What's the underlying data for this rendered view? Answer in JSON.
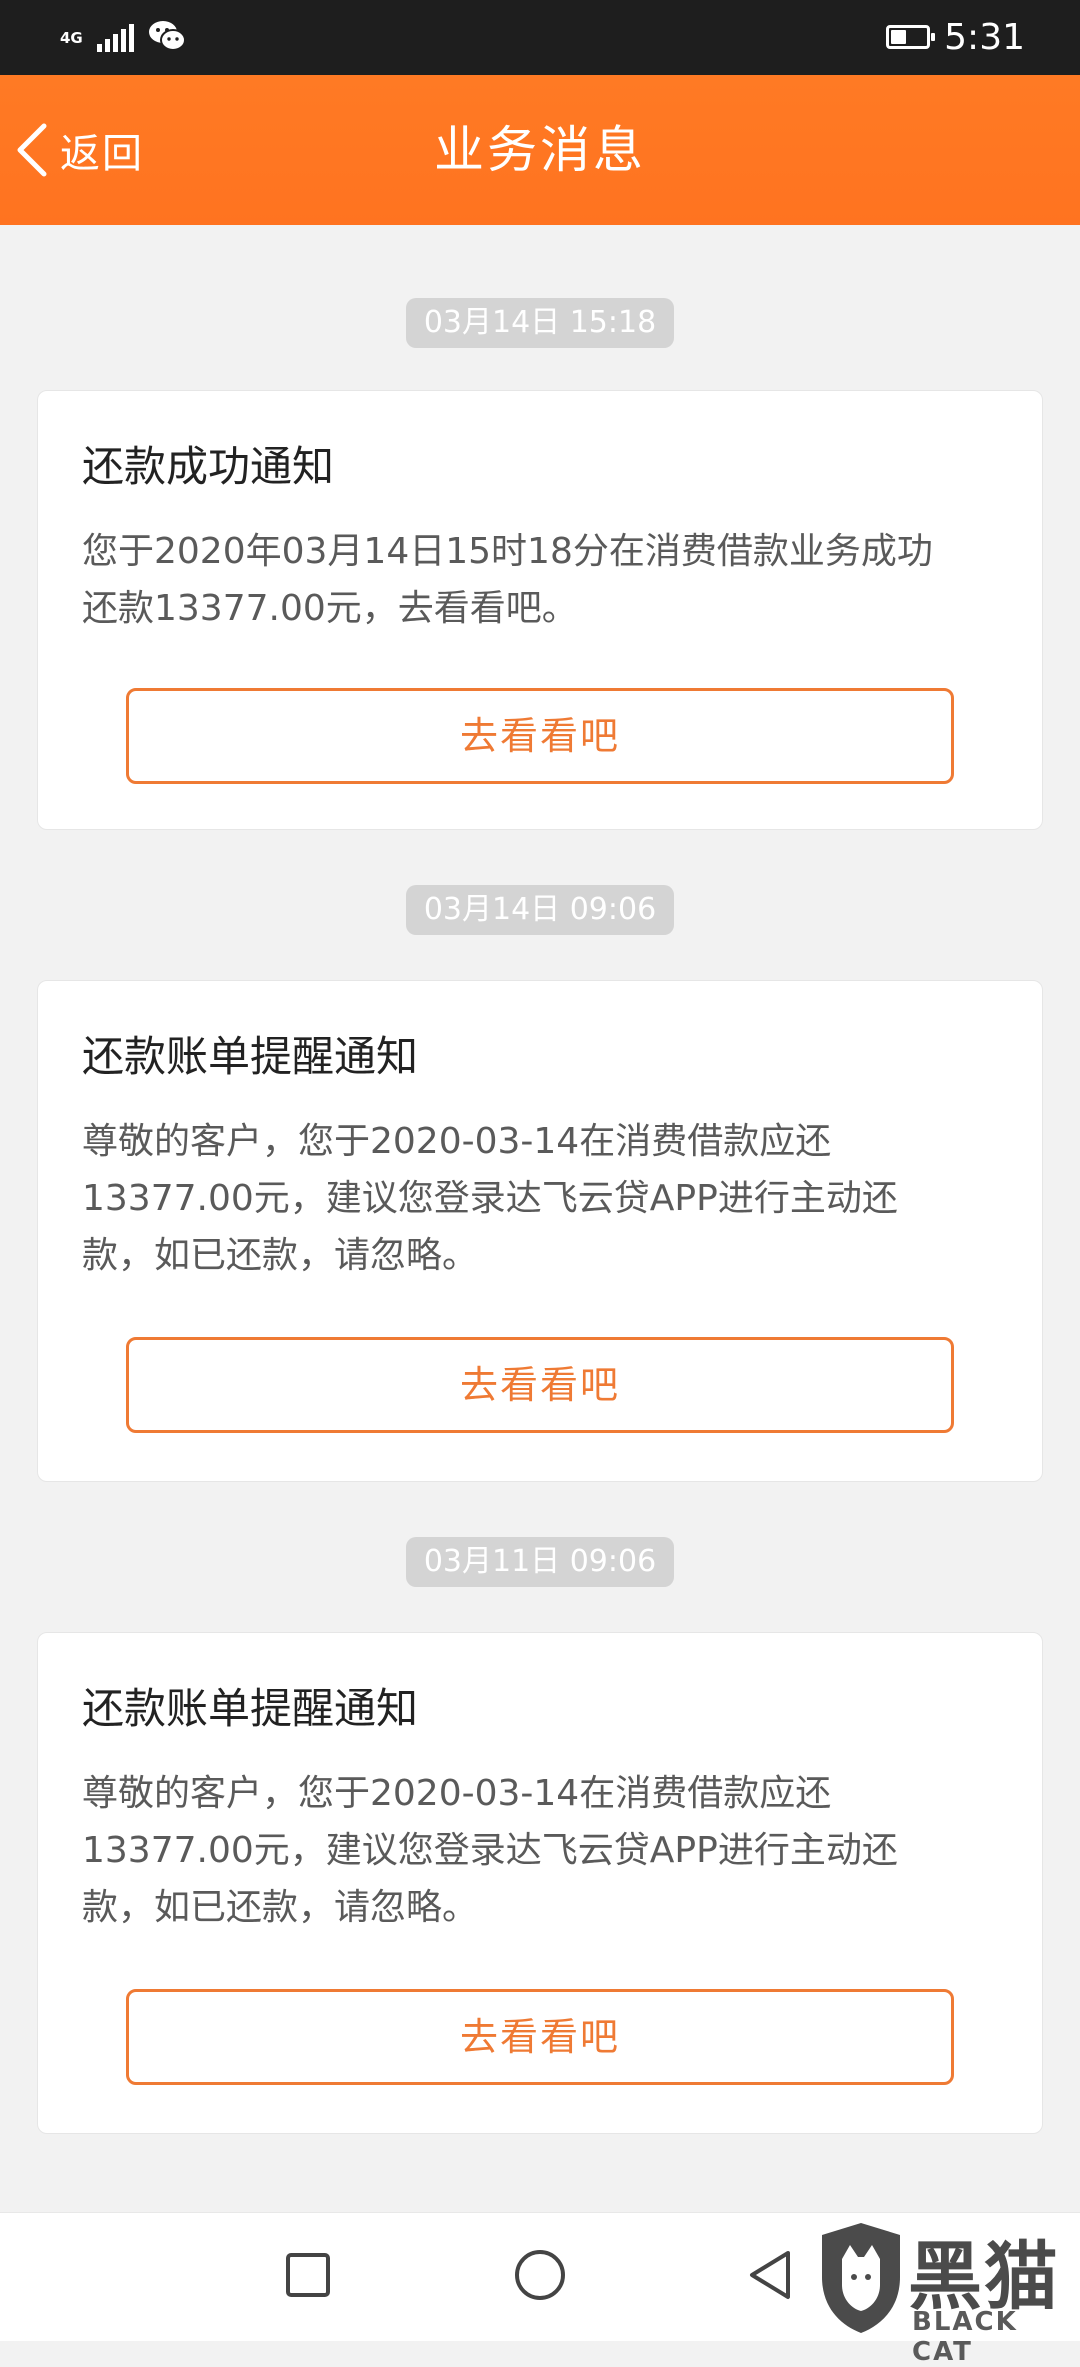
{
  "status_bar": {
    "network_type": "4G",
    "time": "5:31",
    "battery_level": 0.45,
    "signal_icon": "signal-bars-icon",
    "wechat_icon": "wechat-icon"
  },
  "header": {
    "back_label": "返回",
    "title": "业务消息",
    "background_color": "#ff7722"
  },
  "messages": [
    {
      "timestamp": "03月14日 15:18",
      "title": "还款成功通知",
      "body_lines": [
        "您于2020年03月14日15时18分在消费借款业务成功",
        "还款13377.00元，去看看吧。"
      ],
      "button_label": "去看看吧"
    },
    {
      "timestamp": "03月14日 09:06",
      "title": "还款账单提醒通知",
      "body_lines": [
        "尊敬的客户，您于2020-03-14在消费借款应还",
        "13377.00元，建议您登录达飞云贷APP进行主动还",
        "款，如已还款，请忽略。"
      ],
      "button_label": "去看看吧"
    },
    {
      "timestamp": "03月11日 09:06",
      "title": "还款账单提醒通知",
      "body_lines": [
        "尊敬的客户，您于2020-03-14在消费借款应还",
        "13377.00元，建议您登录达飞云贷APP进行主动还",
        "款，如已还款，请忽略。"
      ],
      "button_label": "去看看吧"
    }
  ],
  "accent_color": "#ef7a34",
  "bottom_nav": {
    "recent_icon": "square-icon",
    "home_icon": "circle-icon",
    "back_icon": "triangle-back-icon"
  },
  "watermark": {
    "main": "黑猫",
    "sub": "BLACK CAT"
  }
}
